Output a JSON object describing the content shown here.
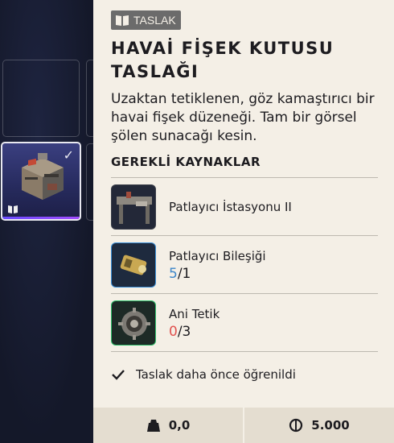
{
  "panel": {
    "tag_label": "TASLAK",
    "title": "HAVAİ FİŞEK KUTUSU TASLAĞI",
    "description": "Uzaktan tetiklenen, göz kamaştırıcı bir havai fişek düzeneği. Tam bir görsel şölen sunacağı kesin.",
    "section_title": "GEREKLİ KAYNAKLAR",
    "resources": [
      {
        "name": "Patlayıcı İstasyonu II",
        "icon": "explosives-station-icon",
        "rarity": "common"
      },
      {
        "name": "Patlayıcı Bileşiği",
        "icon": "explosive-compound-icon",
        "rarity": "uncommon",
        "have": "5",
        "need": "/1"
      },
      {
        "name": "Ani Tetik",
        "icon": "snap-trigger-icon",
        "rarity": "rare",
        "have": "0",
        "need": "/3"
      }
    ],
    "learned_text": "Taslak daha önce öğrenildi",
    "weight": "0,0",
    "price": "5.000"
  },
  "colors": {
    "panel_bg": "#f4efe6",
    "have_enough": "#3c86c9",
    "have_missing": "#e0524f",
    "selected_slot": "#2f3470"
  }
}
